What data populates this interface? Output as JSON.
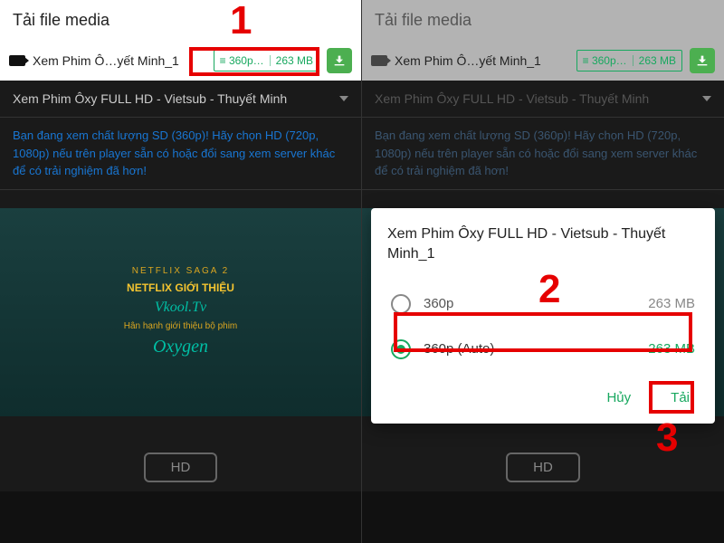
{
  "header_title": "Tải file media",
  "media_name": "Xem Phim Ô…yết Minh_1",
  "quality_badge_res": "≡ 360p…",
  "quality_badge_size": "263 MB",
  "video_title": "Xem Phim Ôxy FULL HD - Vietsub - Thuyết Minh",
  "notice_text": "Bạn đang xem chất lượng SD (360p)! Hãy chọn HD (720p, 1080p) nếu trên player sẵn có hoặc đổi sang xem server khác để có trải nghiệm đã hơn!",
  "player_subs": {
    "s1": "NETFLIX SAGA 2",
    "s2": "NETFLIX GIỚI THIỆU",
    "s3": "Vkool.Tv",
    "s4": "Hân hạnh giới thiệu bộ phim",
    "s5": "Oxygen"
  },
  "hd_btn": "HD",
  "dialog": {
    "title": "Xem Phim Ôxy FULL HD - Vietsub - Thuyết Minh_1",
    "opt1_label": "360p",
    "opt1_size": "263 MB",
    "opt2_label": "360p (Auto)",
    "opt2_size": "263 MB",
    "cancel": "Hủy",
    "download": "Tải"
  },
  "annotations": {
    "n1": "1",
    "n2": "2",
    "n3": "3"
  }
}
